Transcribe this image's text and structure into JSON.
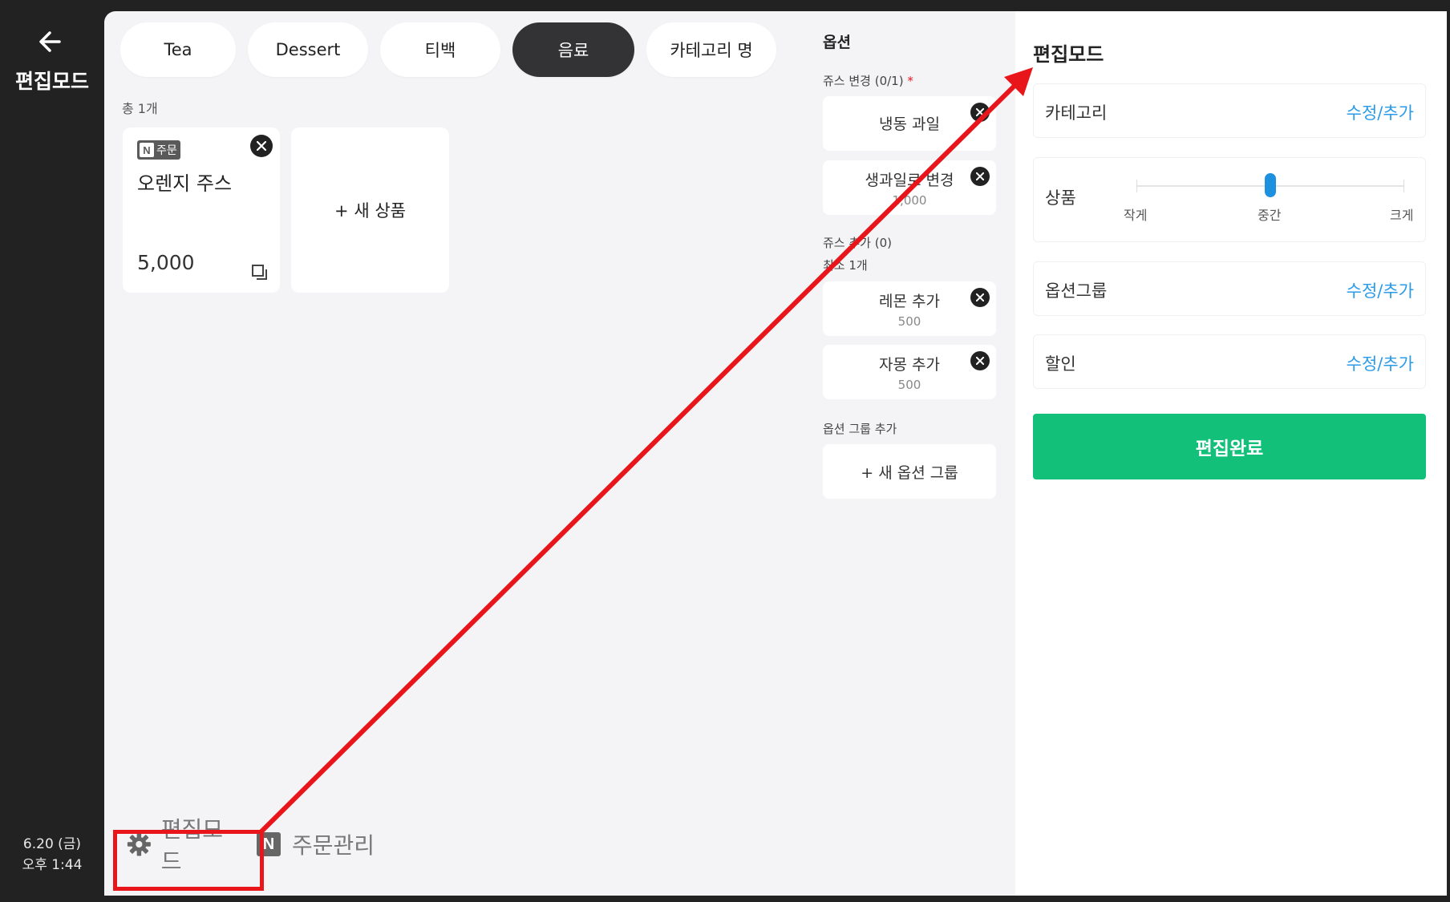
{
  "rail": {
    "back_icon": "back-arrow-icon",
    "title": "편집모드",
    "date": "6.20 (금)",
    "time": "오후 1:44"
  },
  "tabs": [
    {
      "label": "Tea",
      "active": false
    },
    {
      "label": "Dessert",
      "active": false
    },
    {
      "label": "티백",
      "active": false
    },
    {
      "label": "음료",
      "active": true
    },
    {
      "label": "카테고리 명",
      "active": false
    }
  ],
  "product_count": "총 1개",
  "products": [
    {
      "badge": "주문",
      "name": "오렌지 주스",
      "price": "5,000"
    }
  ],
  "new_product_label": "+ 새 상품",
  "bottom_bar": {
    "edit_label": "편집모드",
    "order_label": "주문관리"
  },
  "options": {
    "header": "옵션",
    "group1": {
      "title": "쥬스 변경 (0/1)",
      "required_mark": "*",
      "items": [
        {
          "name": "냉동 과일",
          "price": ""
        },
        {
          "name": "생과일로 변경",
          "price": "1,000"
        }
      ]
    },
    "group2": {
      "title": "쥬스 추가 (0)",
      "subtitle": "최소 1개",
      "items": [
        {
          "name": "레몬 추가",
          "price": "500"
        },
        {
          "name": "자몽 추가",
          "price": "500"
        }
      ]
    },
    "add_group_title": "옵션 그룹 추가",
    "new_group_label": "+ 새 옵션 그룹"
  },
  "panel": {
    "title": "편집모드",
    "category_label": "카테고리",
    "category_action": "수정/추가",
    "product_label": "상품",
    "size_labels": [
      "작게",
      "중간",
      "크게"
    ],
    "size_selected": "중간",
    "option_group_label": "옵션그룹",
    "option_group_action": "수정/추가",
    "discount_label": "할인",
    "discount_action": "수정/추가",
    "done_label": "편집완료"
  },
  "colors": {
    "accent_green": "#12c07a",
    "link_blue": "#2a9be8",
    "slider_blue": "#1e90e0",
    "highlight_red": "#e8161b",
    "dark": "#222222"
  }
}
